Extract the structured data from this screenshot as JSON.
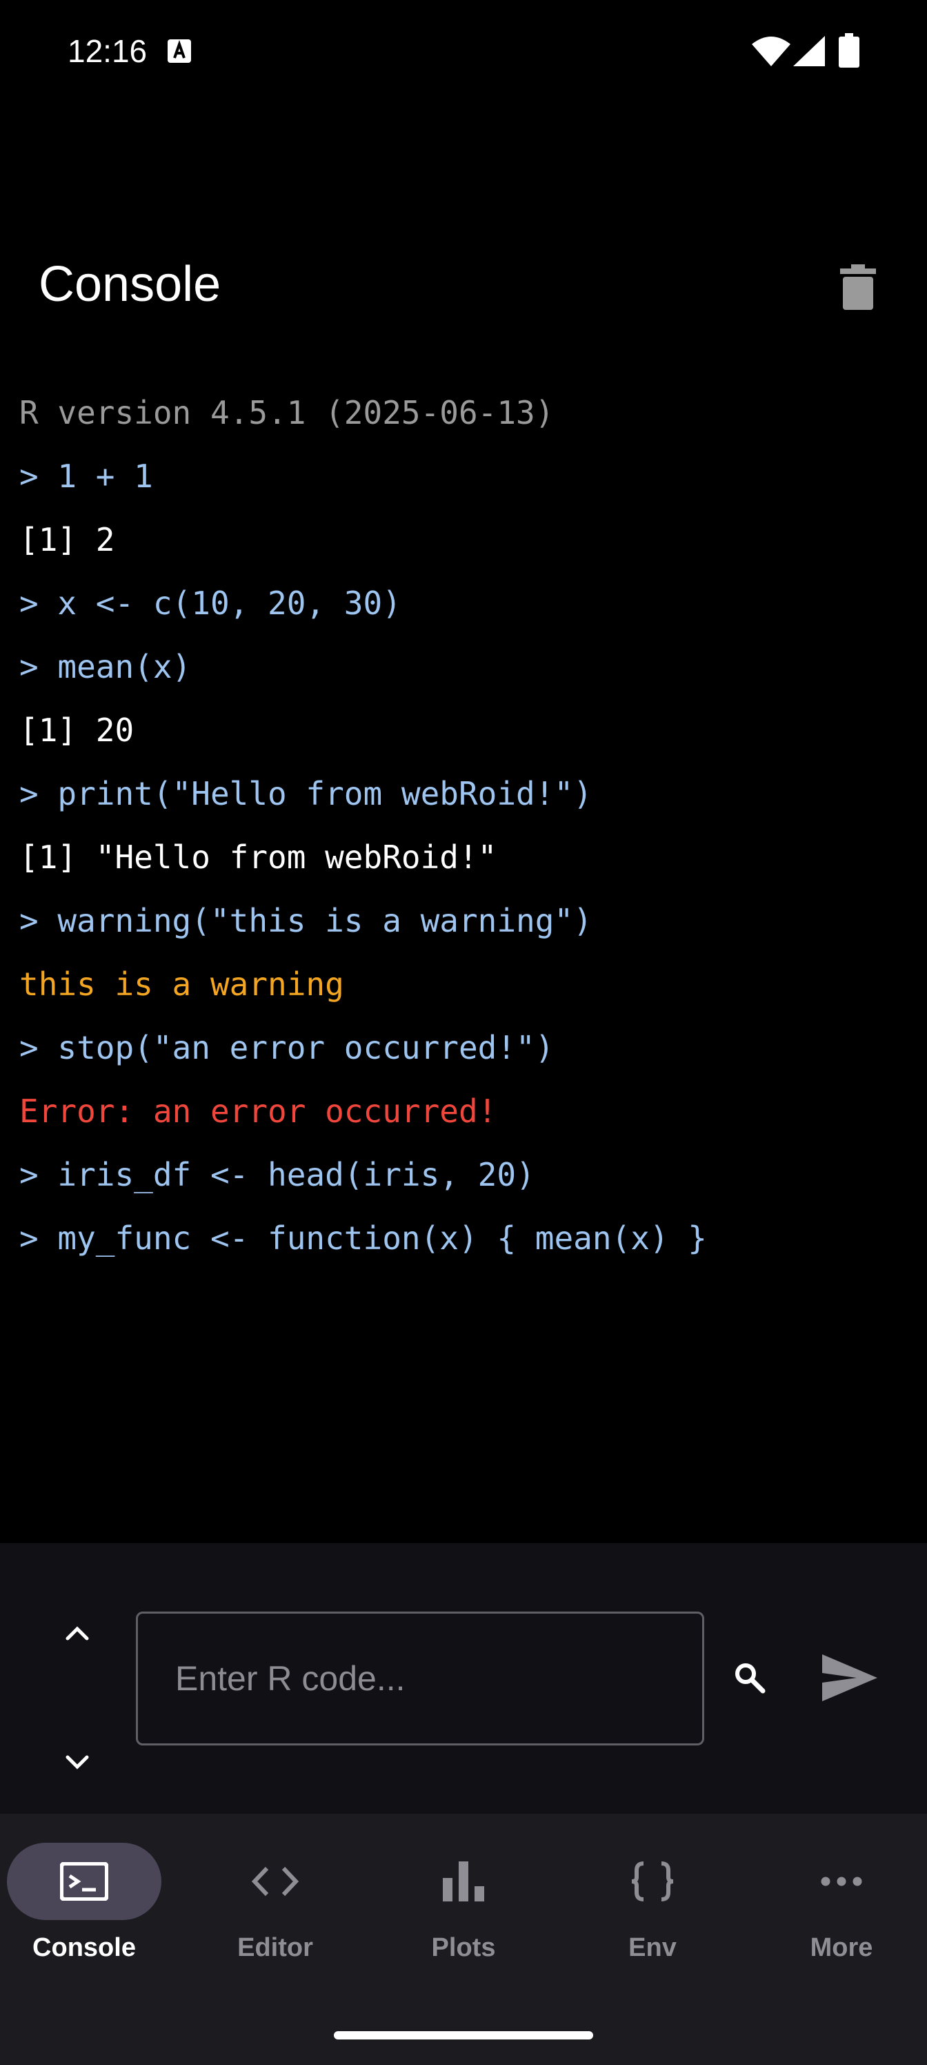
{
  "status_bar": {
    "time": "12:16",
    "icons": [
      "a-notification-icon",
      "wifi-icon",
      "signal-icon",
      "battery-icon"
    ]
  },
  "header": {
    "title": "Console",
    "action_icon": "trash-icon"
  },
  "console": {
    "lines": [
      {
        "text": "R version 4.5.1 (2025-06-13)",
        "kind": "info"
      },
      {
        "text": "> 1 + 1",
        "kind": "input"
      },
      {
        "text": "[1] 2",
        "kind": "output"
      },
      {
        "text": "> x <- c(10, 20, 30)",
        "kind": "input"
      },
      {
        "text": "> mean(x)",
        "kind": "input"
      },
      {
        "text": "[1] 20",
        "kind": "output"
      },
      {
        "text": "> print(\"Hello from webRoid!\")",
        "kind": "input"
      },
      {
        "text": "[1] \"Hello from webRoid!\"",
        "kind": "output"
      },
      {
        "text": "> warning(\"this is a warning\")",
        "kind": "input"
      },
      {
        "text": "this is a warning",
        "kind": "warning"
      },
      {
        "text": "> stop(\"an error occurred!\")",
        "kind": "input"
      },
      {
        "text": "Error: an error occurred!",
        "kind": "error"
      },
      {
        "text": "> iris_df <- head(iris, 20)",
        "kind": "input"
      },
      {
        "text": "> my_func <- function(x) { mean(x) }",
        "kind": "input"
      }
    ]
  },
  "input_bar": {
    "placeholder": "Enter R code...",
    "value": ""
  },
  "bottom_nav": {
    "items": [
      {
        "label": "Console",
        "icon": "terminal-icon",
        "active": true
      },
      {
        "label": "Editor",
        "icon": "code-icon",
        "active": false
      },
      {
        "label": "Plots",
        "icon": "bar-chart-icon",
        "active": false
      },
      {
        "label": "Env",
        "icon": "braces-icon",
        "active": false
      },
      {
        "label": "More",
        "icon": "more-horizontal-icon",
        "active": false
      }
    ]
  },
  "colors": {
    "background": "#000000",
    "info": "#9a9a9a",
    "input": "#9ec4f0",
    "output": "#ffffff",
    "warning": "#f4a623",
    "error": "#f0463c",
    "nav_background": "#1c1b20",
    "nav_active_pill": "#4a4658"
  }
}
